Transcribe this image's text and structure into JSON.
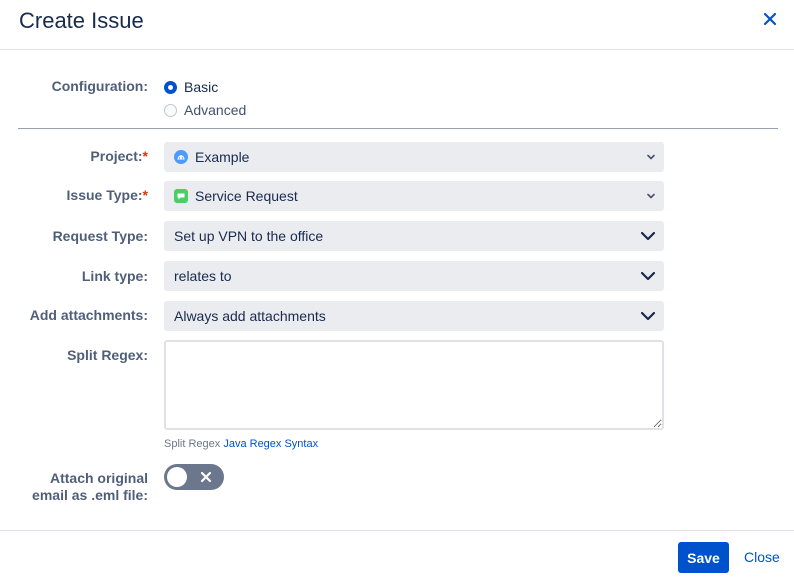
{
  "dialog": {
    "title": "Create Issue",
    "close_icon": "close-icon"
  },
  "configuration": {
    "label": "Configuration:",
    "options": [
      {
        "label": "Basic",
        "selected": true
      },
      {
        "label": "Advanced",
        "selected": false
      }
    ]
  },
  "fields": {
    "project": {
      "label": "Project:",
      "required_mark": "*",
      "value": "Example",
      "icon": "project-avatar-icon"
    },
    "issue_type": {
      "label": "Issue Type:",
      "required_mark": "*",
      "value": "Service Request",
      "icon": "service-request-icon"
    },
    "request_type": {
      "label": "Request Type:",
      "value": "Set up VPN to the office"
    },
    "link_type": {
      "label": "Link type:",
      "value": "relates to"
    },
    "add_attachments": {
      "label": "Add attachments:",
      "value": "Always add attachments"
    },
    "split_regex": {
      "label": "Split Regex:",
      "value": "",
      "help_text": "Split Regex",
      "help_link": "Java Regex Syntax"
    },
    "attach_eml": {
      "label_line1": "Attach original",
      "label_line2": "email as .eml file:",
      "enabled": false
    }
  },
  "footer": {
    "save_label": "Save",
    "close_label": "Close"
  },
  "colors": {
    "accent": "#0052cc",
    "required": "#de350b",
    "toggle_off": "#6b778c"
  }
}
